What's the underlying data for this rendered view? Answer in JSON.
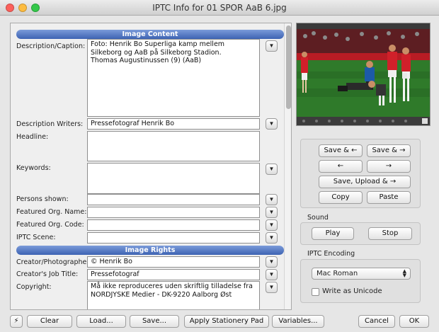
{
  "window": {
    "title": "IPTC Info for 01 SPOR AaB 6.jpg"
  },
  "sections": {
    "content": "Image Content",
    "rights": "Image Rights"
  },
  "fields": {
    "description": {
      "label": "Description/Caption:",
      "value": "Foto: Henrik Bo Superliga kamp mellem Silkeborg og AaB på Silkeborg Stadion.\nThomas Augustinussen (9) (AaB)"
    },
    "writers": {
      "label": "Description Writers:",
      "value": "Pressefotograf Henrik Bo"
    },
    "headline": {
      "label": "Headline:",
      "value": ""
    },
    "keywords": {
      "label": "Keywords:",
      "value": ""
    },
    "persons": {
      "label": "Persons shown:",
      "value": ""
    },
    "org_name": {
      "label": "Featured Org. Name:",
      "value": ""
    },
    "org_code": {
      "label": "Featured Org. Code:",
      "value": ""
    },
    "scene": {
      "label": "IPTC Scene:",
      "value": ""
    },
    "creator": {
      "label": "Creator/Photographer:",
      "value": "© Henrik Bo"
    },
    "job_title": {
      "label": "Creator's Job Title:",
      "value": "Pressefotograf"
    },
    "copyright": {
      "label": "Copyright:",
      "value": "Må ikke reproduceres uden skriftlig tilladelse fra\nNORDJYSKE Medier - DK-9220 Aalborg Øst"
    }
  },
  "dropdown_glyph": "▼",
  "actions": {
    "save_prev": "Save & ←",
    "save_next": "Save & →",
    "prev": "←",
    "next": "→",
    "save_upload": "Save, Upload & →",
    "copy": "Copy",
    "paste": "Paste"
  },
  "sound": {
    "label": "Sound",
    "play": "Play",
    "stop": "Stop"
  },
  "encoding": {
    "label": "IPTC Encoding",
    "selected": "Mac Roman",
    "unicode_label": "Write as Unicode"
  },
  "bottom": {
    "clear": "Clear",
    "load": "Load...",
    "save": "Save...",
    "apply": "Apply Stationery Pad",
    "variables": "Variables...",
    "cancel": "Cancel",
    "ok": "OK"
  },
  "colors": {
    "section_header": "#4a6fc0",
    "pitch": "#2f7a2a",
    "kit_red": "#d0202a"
  },
  "icons": {
    "lightning": "⚡"
  }
}
